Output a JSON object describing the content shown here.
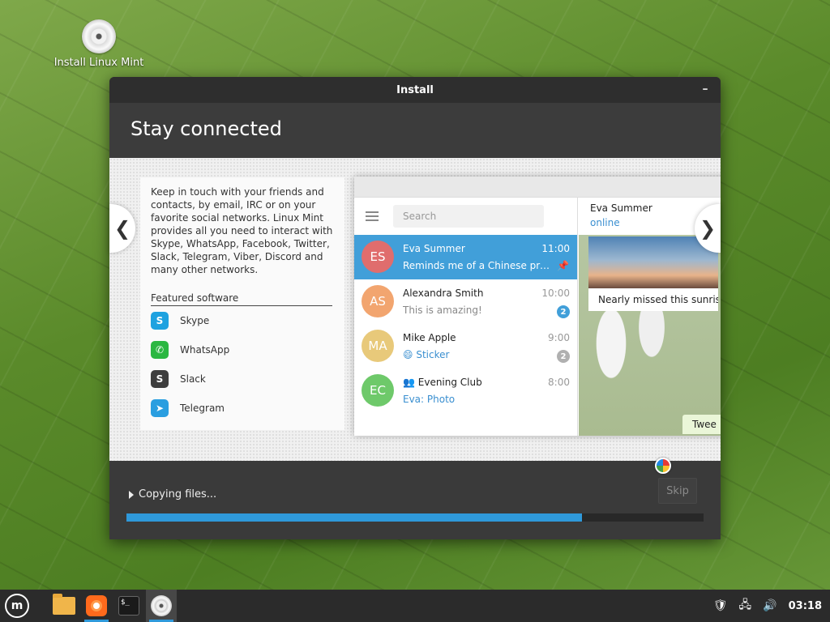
{
  "desktop": {
    "icon_label": "Install Linux Mint"
  },
  "window": {
    "title": "Install",
    "minimize_glyph": "–",
    "heading": "Stay connected",
    "description": "Keep in touch with your friends and contacts, by email, IRC or on your favorite social networks. Linux Mint provides all you need to interact with Skype, WhatsApp, Facebook, Twitter, Slack, Telegram, Viber, Discord and many other networks.",
    "featured_title": "Featured software",
    "featured": [
      {
        "name": "Skype",
        "icon": "skype-icon",
        "color": "#1ea2e0",
        "glyph": "S"
      },
      {
        "name": "WhatsApp",
        "icon": "whatsapp-icon",
        "color": "#2bb741",
        "glyph": "✆"
      },
      {
        "name": "Slack",
        "icon": "slack-icon",
        "color": "#3e3e3e",
        "glyph": "S"
      },
      {
        "name": "Telegram",
        "icon": "telegram-icon",
        "color": "#2a9ee0",
        "glyph": "➤"
      }
    ],
    "prev_glyph": "❮",
    "next_glyph": "❯",
    "status": "Copying files...",
    "skip_label": "Skip",
    "progress": 0.79
  },
  "telegram": {
    "search_placeholder": "Search",
    "chats": [
      {
        "initials": "ES",
        "color": "#e06d6d",
        "name": "Eva Summer",
        "time": "11:00",
        "message": "Reminds me of a Chinese proverb...",
        "pinned": true,
        "active": true
      },
      {
        "initials": "AS",
        "color": "#f2a56f",
        "name": "Alexandra Smith",
        "time": "10:00",
        "message": "This is amazing!",
        "badge": "2"
      },
      {
        "initials": "MA",
        "color": "#e8c97a",
        "name": "Mike Apple",
        "time": "9:00",
        "message": "😄 Sticker",
        "badge": "2"
      },
      {
        "initials": "EC",
        "color": "#6ec96a",
        "name": "👥 Evening Club",
        "time": "8:00",
        "message": "Eva: Photo"
      }
    ],
    "contact_name": "Eva Summer",
    "contact_status": "online",
    "bubble_text": "Nearly missed this sunrise",
    "bubble2_text": "Twee"
  },
  "taskbar": {
    "items": [
      {
        "name": "mint-menu-icon"
      },
      {
        "name": "files-icon"
      },
      {
        "name": "firefox-icon"
      },
      {
        "name": "terminal-icon",
        "glyph": "$_"
      },
      {
        "name": "installer-icon"
      }
    ],
    "clock": "03:18"
  }
}
